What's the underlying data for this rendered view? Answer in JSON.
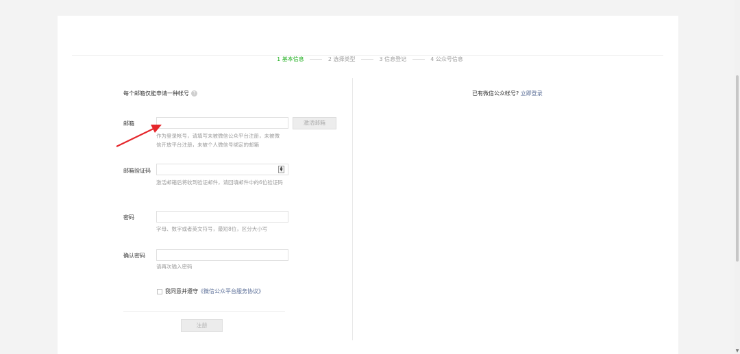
{
  "steps": [
    {
      "label": "1 基本信息",
      "active": true
    },
    {
      "label": "2 选择类型",
      "active": false
    },
    {
      "label": "3 信息登记",
      "active": false
    },
    {
      "label": "4 公众号信息",
      "active": false
    }
  ],
  "form": {
    "tip": "每个邮箱仅能申请一种帐号",
    "help_icon": "?",
    "email": {
      "label": "邮箱",
      "value": "",
      "button": "激活邮箱",
      "hint": "作为登录帐号，请填写未被微信公众平台注册，未被微信开放平台注册，未被个人微信号绑定的邮箱"
    },
    "code": {
      "label": "邮箱验证码",
      "value": "",
      "hint": "激活邮箱后将收到验证邮件，请回填邮件中的6位验证码"
    },
    "password": {
      "label": "密码",
      "value": "",
      "hint": "字母、数字或者英文符号，最短8位，区分大小写"
    },
    "confirm": {
      "label": "确认密码",
      "value": "",
      "hint": "请再次输入密码"
    },
    "agree": {
      "text": "我同意并遵守",
      "link": "《微信公众平台服务协议》",
      "checked": false
    },
    "register_button": "注册"
  },
  "side": {
    "text": "已有微信公众帐号?",
    "link": "立即登录"
  },
  "colors": {
    "accent_green": "#1aad19",
    "link_blue": "#576b95",
    "annotation_red": "#e5262b"
  }
}
